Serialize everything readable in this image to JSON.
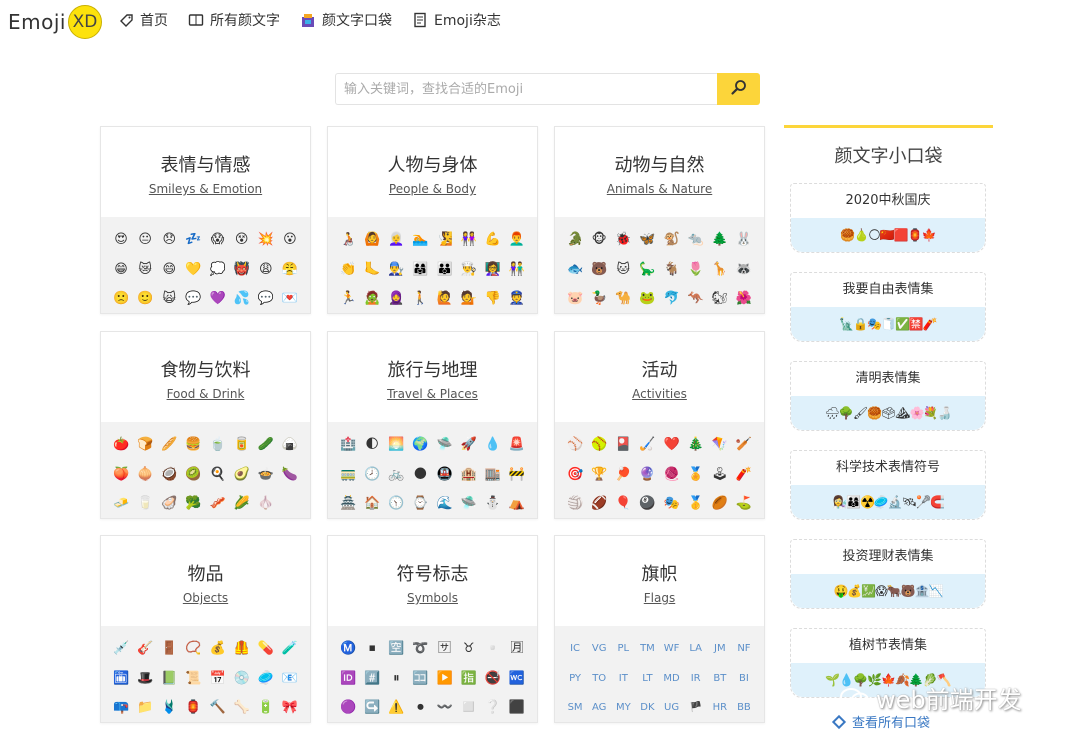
{
  "nav": {
    "logo_text": "Emoji",
    "logo_badge": "XD",
    "links": [
      {
        "label": "首页",
        "icon": "tag-icon"
      },
      {
        "label": "所有颜文字",
        "icon": "book-icon"
      },
      {
        "label": "颜文字口袋",
        "icon": "bag-icon"
      },
      {
        "label": "Emoji杂志",
        "icon": "magazine-icon"
      }
    ]
  },
  "search": {
    "placeholder": "输入关键词，查找合适的Emoji",
    "button_icon": "search-icon"
  },
  "categories": [
    {
      "title": "表情与情感",
      "subtitle": "Smileys & Emotion",
      "emojis": [
        "😍",
        "😐",
        "😞",
        "💤",
        "😱",
        "😵",
        "💥",
        "😮",
        "😁",
        "😿",
        "😄",
        "💛",
        "💭",
        "👹",
        "😩",
        "😤",
        "🙁",
        "🙂",
        "🙀",
        "💬",
        "💜",
        "💦",
        "💬",
        "💌"
      ]
    },
    {
      "title": "人物与身体",
      "subtitle": "People & Body",
      "emojis": [
        "🧑‍🦽",
        "🙆",
        "👩‍🦳",
        "🏊",
        "🧏",
        "👭",
        "💪",
        "👨‍🦰",
        "👏",
        "🦶",
        "👨‍🔧",
        "👨‍👩‍👧",
        "👪",
        "👨‍🍳",
        "👩‍🏫",
        "👫",
        "🏃",
        "🧟",
        "🧕",
        "🚶",
        "🙋",
        "💁",
        "👎",
        "👮"
      ]
    },
    {
      "title": "动物与自然",
      "subtitle": "Animals & Nature",
      "emojis": [
        "🐊",
        "🐵",
        "🐞",
        "🦋",
        "🐒",
        "🐀",
        "🌲",
        "🐰",
        "🐟",
        "🐻",
        "🐱",
        "🦕",
        "🐐",
        "🌷",
        "🦒",
        "🦝",
        "🐷",
        "🦆",
        "🐪",
        "🐸",
        "🐬",
        "🦘",
        "🐿",
        "🌺"
      ]
    },
    {
      "title": "食物与饮料",
      "subtitle": "Food & Drink",
      "emojis": [
        "🍅",
        "🍞",
        "🥖",
        "🍔",
        "🍵",
        "🥫",
        "🥒",
        "🍙",
        "🍑",
        "🧅",
        "🥥",
        "🥝",
        "🍳",
        "🥑",
        "🍲",
        "🍆",
        "🧈",
        "🥛",
        "🦪",
        "🥦",
        "🥓",
        "🌽",
        "🧄"
      ]
    },
    {
      "title": "旅行与地理",
      "subtitle": "Travel & Places",
      "emojis": [
        "🏥",
        "🌓",
        "🌅",
        "🌍",
        "🛸",
        "🚀",
        "💧",
        "🚨",
        "🚃",
        "🕗",
        "🚲",
        "🌑",
        "🚇",
        "🏨",
        "🏬",
        "🚧",
        "🏯",
        "🏠",
        "🕥",
        "⌚",
        "🌊",
        "🛸",
        "⛄",
        "⛺"
      ]
    },
    {
      "title": "活动",
      "subtitle": "Activities",
      "emojis": [
        "⚾",
        "🥎",
        "🎴",
        "🏑",
        "❤️",
        "🎄",
        "🪁",
        "🏏",
        "🎯",
        "🏆",
        "🏓",
        "🔮",
        "🧶",
        "🏅",
        "🕹",
        "🧨",
        "🏐",
        "🏈",
        "🎈",
        "🎱",
        "🎭",
        "🥇",
        "🏉",
        "⛳"
      ]
    },
    {
      "title": "物品",
      "subtitle": "Objects",
      "emojis": [
        "💉",
        "🎸",
        "🚪",
        "📿",
        "💰",
        "🦺",
        "💊",
        "🧪",
        "🛅",
        "🎩",
        "📗",
        "📜",
        "📅",
        "💿",
        "🥏",
        "📧",
        "📪",
        "📁",
        "🩱",
        "🏮",
        "🔨",
        "🦴",
        "🔋",
        "🎀"
      ]
    },
    {
      "title": "符号标志",
      "subtitle": "Symbols",
      "emojis": [
        "Ⓜ️",
        "⏹",
        "🈳",
        "➰",
        "🈂",
        "♉",
        "▫️",
        "🈷",
        "🆔",
        "#️⃣",
        "⏸",
        "🈁",
        "▶️",
        "🈯",
        "🚭",
        "🚾",
        "🟣",
        "↪️",
        "⚠️",
        "⏺",
        "〰️",
        "◻️",
        "❔",
        "⬛"
      ]
    },
    {
      "title": "旗帜",
      "subtitle": "Flags",
      "flags": [
        "IC",
        "VG",
        "PL",
        "TM",
        "WF",
        "LA",
        "JM",
        "NF",
        "PY",
        "TO",
        "IT",
        "LT",
        "MD",
        "IR",
        "BT",
        "BI",
        "SM",
        "AG",
        "MY",
        "DK",
        "UG",
        "🏴",
        "HR",
        "BB"
      ]
    }
  ],
  "sidebar": {
    "title": "颜文字小口袋",
    "packs": [
      {
        "name": "2020中秋国庆",
        "emojis": "🥮🍐🌕🇨🇳🟥🏮🍁"
      },
      {
        "name": "我要自由表情集",
        "emojis": "🗽🔒🎭🧻✅🈲🧨"
      },
      {
        "name": "清明表情集",
        "emojis": "🌧🌳🖌🥮🗳⛰🌸💐🍶"
      },
      {
        "name": "科学技术表情符号",
        "emojis": "👩‍🔬👨‍👩‍👦☢️🥏🔬🛰🥍🧲"
      },
      {
        "name": "投资理财表情集",
        "emojis": "🤑💰💹😱🐂🐻🏦📉"
      },
      {
        "name": "植树节表情集",
        "emojis": "🌱💧🌳🌿🍁🍂🌲🥬🪓"
      }
    ],
    "see_all": "查看所有口袋"
  },
  "watermark": "web前端开发"
}
